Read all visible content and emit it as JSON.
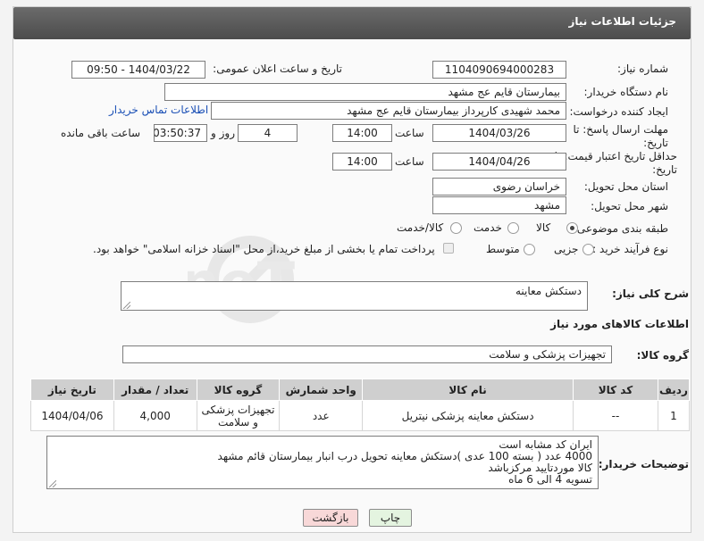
{
  "header": {
    "title": "جزئیات اطلاعات نیاز"
  },
  "fields": {
    "need_number_label": "شماره نیاز:",
    "need_number": "1104090694000283",
    "announce_label": "تاریخ و ساعت اعلان عمومی:",
    "announce_value": "1404/03/22 - 09:50",
    "buyer_label": "نام دستگاه خریدار:",
    "buyer_value": "بیمارستان قایم  عج  مشهد",
    "creator_label": "ایجاد کننده درخواست:",
    "creator_value": "محمد شهیدی کارپرداز بیمارستان قایم  عج  مشهد",
    "contact_link": "اطلاعات تماس خریدار",
    "reply_label": "مهلت ارسال پاسخ: تا تاریخ:",
    "reply_date": "1404/03/26",
    "time_label": "ساعت",
    "reply_time": "14:00",
    "days_value": "4",
    "days_label": "روز و",
    "remaining_value": "03:50:37",
    "remaining_label": "ساعت باقی مانده",
    "price_label": "حداقل تاریخ اعتبار قیمت: تا تاریخ:",
    "price_date": "1404/04/26",
    "price_time": "14:00",
    "province_label": "استان محل تحویل:",
    "province_value": "خراسان رضوی",
    "city_label": "شهر محل تحویل:",
    "city_value": "مشهد",
    "category_label": "طبقه بندی موضوعی:",
    "category_options": [
      "کالا",
      "خدمت",
      "کالا/خدمت"
    ],
    "category_selected": "کالا",
    "process_label": "نوع فرآیند خرید :",
    "process_options": [
      "جزیی",
      "متوسط"
    ],
    "process_note": "پرداخت تمام یا بخشی از مبلغ خرید،از محل \"اسناد خزانه اسلامی\" خواهد بود."
  },
  "description": {
    "label": "شرح کلی نیاز:",
    "value": "دستکش معاینه"
  },
  "goods": {
    "title": "اطلاعات کالاهای مورد نیاز",
    "group_label": "گروه کالا:",
    "group_value": "تجهیزات پزشکی و سلامت",
    "columns": [
      "ردیف",
      "کد کالا",
      "نام کالا",
      "واحد شمارش",
      "گروه کالا",
      "تعداد / مقدار",
      "تاریخ نیاز"
    ],
    "rows": [
      [
        "1",
        "--",
        "دستکش معاینه پزشکی نیتریل",
        "عدد",
        "تجهیزات پزشکی و سلامت",
        "4,000",
        "1404/04/06"
      ]
    ]
  },
  "buyer_notes": {
    "label": "توضیحات خریدار:",
    "lines": [
      "ایران کد مشابه  است",
      "4000 عدد ( بسته 100 عدی )دستکش معاینه تحویل درب انبار  بیمارستان  قائم مشهد",
      "کالا  موردتایید مرکزباشد",
      "تسویه 4 الی 6 ماه"
    ]
  },
  "buttons": {
    "print": "چاپ",
    "back": "بازگشت"
  },
  "watermark": {
    "text": "AriaTender.neT"
  },
  "colors": {
    "header": "#5a5a5a",
    "link": "#1a4fb5",
    "back_button": "#f8d8d8",
    "print_button": "#e4f4e0"
  }
}
